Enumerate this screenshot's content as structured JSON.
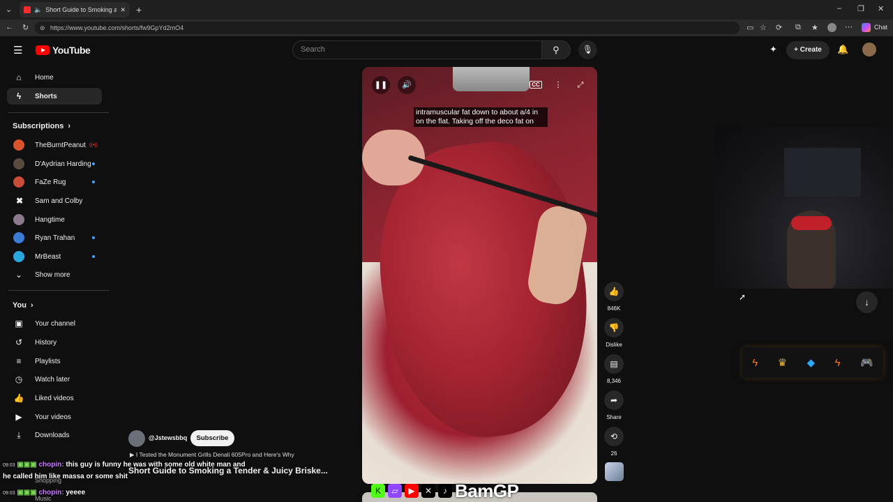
{
  "browser": {
    "tab_title": "Short Guide to Smoking a Ter",
    "url": "https://www.youtube.com/shorts/fw9GpYd2mO4",
    "chat_label": "Chat"
  },
  "header": {
    "logo_text": "YouTube",
    "search_placeholder": "Search",
    "create_label": "Create"
  },
  "sidebar": {
    "top": [
      {
        "label": "Home",
        "icon": "home-icon"
      },
      {
        "label": "Shorts",
        "icon": "shorts-icon"
      }
    ],
    "subscriptions_heading": "Subscriptions",
    "subscriptions": [
      {
        "label": "TheBurntPeanut",
        "status": "live",
        "color": "#d9542b"
      },
      {
        "label": "D'Aydrian Harding",
        "status": "new",
        "color": "#5b4a3f"
      },
      {
        "label": "FaZe Rug",
        "status": "new",
        "color": "#c94b3a"
      },
      {
        "label": "Sam and Colby",
        "status": "",
        "color": "#ffffff"
      },
      {
        "label": "Hangtime",
        "status": "",
        "color": "#8b7a8c"
      },
      {
        "label": "Ryan Trahan",
        "status": "new",
        "color": "#3a7bd5"
      },
      {
        "label": "MrBeast",
        "status": "new",
        "color": "#29a8e0"
      }
    ],
    "show_more": "Show more",
    "you_heading": "You",
    "you_items": [
      {
        "label": "Your channel",
        "icon": "your-channel-icon"
      },
      {
        "label": "History",
        "icon": "history-icon"
      },
      {
        "label": "Playlists",
        "icon": "playlists-icon"
      },
      {
        "label": "Watch later",
        "icon": "watch-later-icon"
      },
      {
        "label": "Liked videos",
        "icon": "liked-videos-icon"
      },
      {
        "label": "Your videos",
        "icon": "your-videos-icon"
      },
      {
        "label": "Downloads",
        "icon": "downloads-icon"
      }
    ]
  },
  "video": {
    "caption_line1": "intramuscular fat down to about a/4 in",
    "caption_line2": "on the flat. Taking off the deco fat on"
  },
  "actions": {
    "likes": "846K",
    "dislike": "Dislike",
    "comments": "8,346",
    "share": "Share",
    "remix": "26"
  },
  "channel": {
    "handle": "@Jstewsbbq",
    "subscribe": "Subscribe",
    "related_video": "I Tested the Monument Grills Denali 605Pro and Here's Why",
    "short_title": "Short Guide to Smoking a Tender & Juicy Briske..."
  },
  "chat": [
    {
      "time": "09:03",
      "user": "chopin:",
      "text": "this guy is funny he was with some old white man and"
    },
    {
      "time": "",
      "user": "",
      "text": "he called him like massa or some shit"
    },
    {
      "time": "09:03",
      "user": "chopin:",
      "text": "yeeee"
    }
  ],
  "overlay": {
    "streamer_name": "BamGP",
    "behind_text_1": "Shopping",
    "behind_text_2": "Music"
  },
  "colors": {
    "accent_red": "#ff0000",
    "link_blue": "#3ea6ff",
    "chat_user": "#c77dff"
  }
}
